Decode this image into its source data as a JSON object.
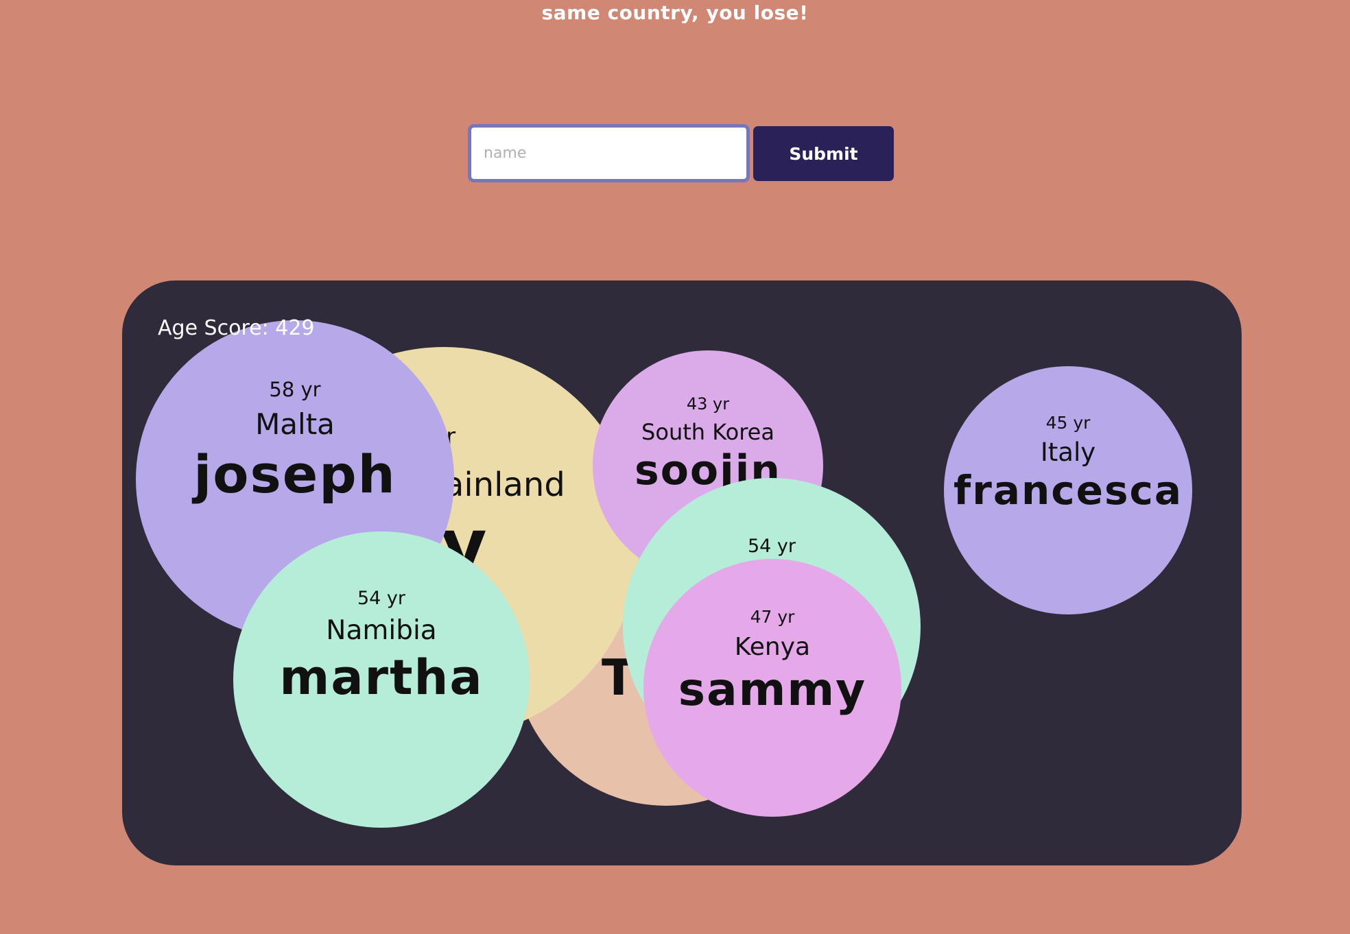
{
  "header": {
    "instructions": "same country, you lose!"
  },
  "form": {
    "input_placeholder": "name",
    "input_value": "",
    "submit_label": "Submit"
  },
  "board": {
    "score_text": "Age Score: 429",
    "bubbles": [
      {
        "id": "peach",
        "age": "",
        "country": "",
        "name": "T",
        "color": "#e8c1aa"
      },
      {
        "id": "yellow",
        "age": "yr",
        "country": "ainland",
        "name": "y",
        "color": "#ebdcaa"
      },
      {
        "id": "joseph",
        "age": "58 yr",
        "country": "Malta",
        "name": "joseph",
        "color": "#b7a9e9"
      },
      {
        "id": "soojin",
        "age": "43 yr",
        "country": "South Korea",
        "name": "soojin",
        "color": "#dbaae9"
      },
      {
        "id": "francesca",
        "age": "45 yr",
        "country": "Italy",
        "name": "francesca",
        "color": "#b7a9e9"
      },
      {
        "id": "namibia54",
        "age": "54 yr",
        "country": "Namibia",
        "name": "martha",
        "color": "#b5edd8"
      },
      {
        "id": "hidden54",
        "age": "54 yr",
        "country": "",
        "name": "",
        "color": "#b5edd8"
      },
      {
        "id": "sammy",
        "age": "47 yr",
        "country": "Kenya",
        "name": "sammy",
        "color": "#e5a9e9"
      }
    ]
  }
}
